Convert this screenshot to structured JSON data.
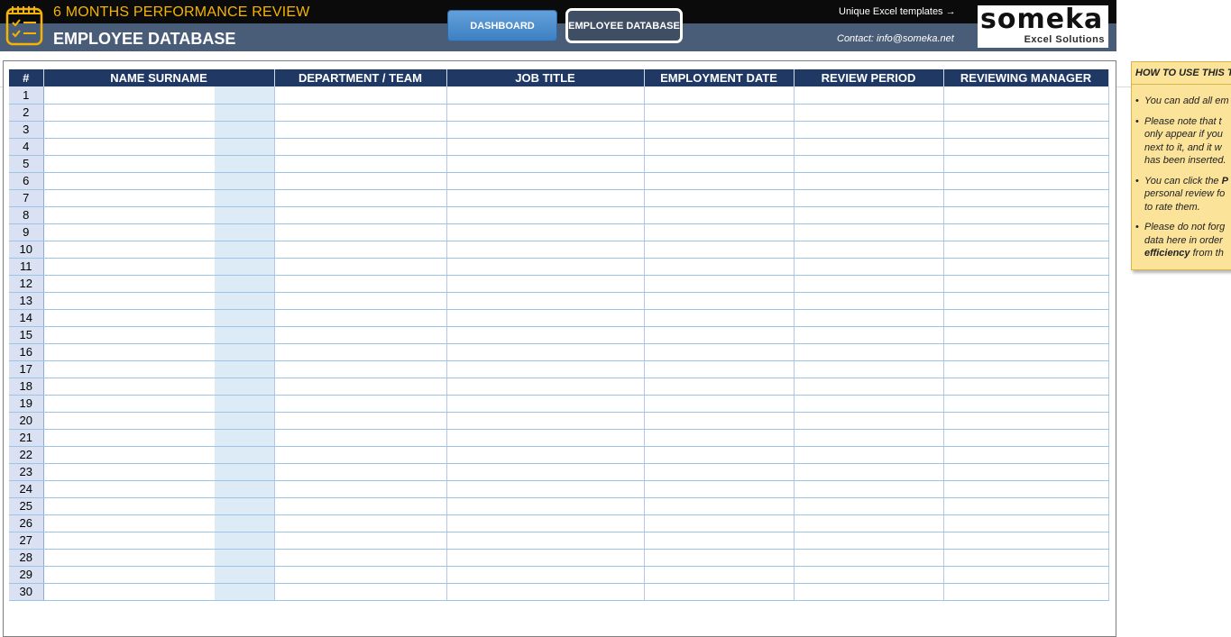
{
  "header": {
    "subtitle": "6 MONTHS PERFORMANCE REVIEW",
    "title": "EMPLOYEE DATABASE",
    "nav": {
      "dashboard": "DASHBOARD",
      "employee_database": "EMPLOYEE DATABASE"
    },
    "templates_link": "Unique Excel templates →",
    "contact": "Contact: info@someka.net",
    "logo": {
      "main": "someka",
      "sub": "Excel Solutions"
    },
    "icon": "checklist-icon",
    "colors": {
      "accent": "#f5b400",
      "banner": "#4a5d78",
      "table_header": "#1f3864"
    }
  },
  "table": {
    "columns": [
      "#",
      "NAME SURNAME",
      "DEPARTMENT / TEAM",
      "JOB TITLE",
      "EMPLOYMENT DATE",
      "REVIEW PERIOD",
      "REVIEWING MANAGER"
    ],
    "rows": [
      "1",
      "2",
      "3",
      "4",
      "5",
      "6",
      "7",
      "8",
      "9",
      "10",
      "11",
      "12",
      "13",
      "14",
      "15",
      "16",
      "17",
      "18",
      "19",
      "20",
      "21",
      "22",
      "23",
      "24",
      "25",
      "26",
      "27",
      "28",
      "29",
      "30"
    ]
  },
  "help_panel": {
    "title": "HOW TO USE THIS T",
    "items": [
      {
        "lines": [
          "You can add all em"
        ]
      },
      {
        "lines": [
          "Please note that t",
          "only appear if you",
          "next to it, and it w",
          "has been inserted."
        ]
      },
      {
        "lines": [
          "You can click the",
          "personal review fo",
          "to rate them."
        ],
        "bold_tail_line0": "P"
      },
      {
        "lines": [
          "Please do not forg",
          "data here in order",
          "from th"
        ],
        "bold_head_line2": "efficiency"
      }
    ]
  }
}
